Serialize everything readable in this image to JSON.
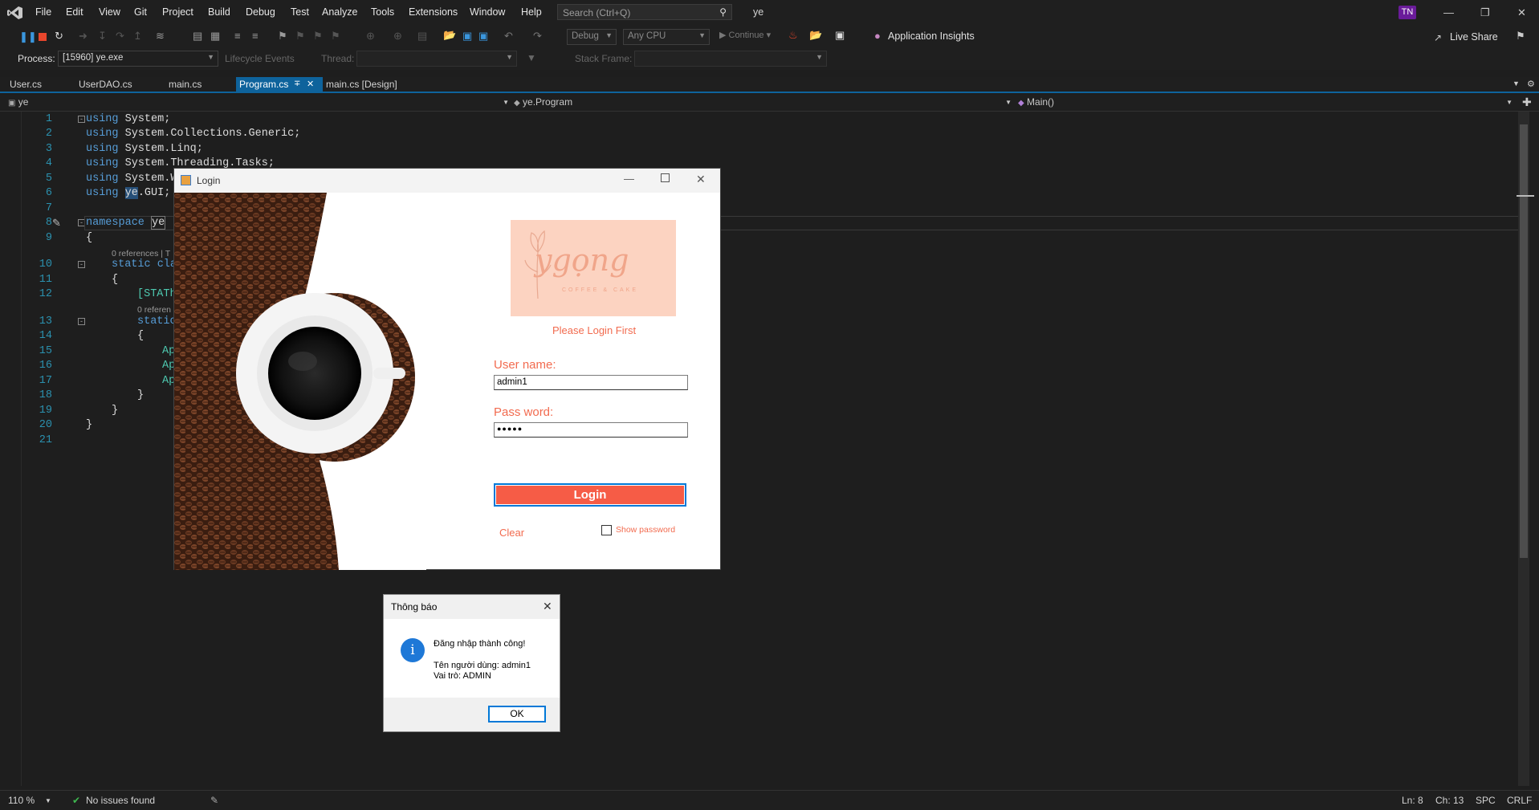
{
  "menu": [
    "File",
    "Edit",
    "View",
    "Git",
    "Project",
    "Build",
    "Debug",
    "Test",
    "Analyze",
    "Tools",
    "Extensions",
    "Window",
    "Help"
  ],
  "search": {
    "placeholder": "Search (Ctrl+Q)"
  },
  "solution_name": "ye",
  "user_initials": "TN",
  "toolbar": {
    "config": "Debug",
    "platform": "Any CPU",
    "continue_label": "Continue",
    "app_insights": "Application Insights",
    "live_share": "Live Share",
    "process_label": "Process:",
    "process_value": "[15960] ye.exe",
    "lifecycle": "Lifecycle Events",
    "thread_label": "Thread:",
    "stack_label": "Stack Frame:"
  },
  "tabs": [
    "User.cs",
    "UserDAO.cs",
    "main.cs",
    "Program.cs",
    "main.cs [Design]"
  ],
  "active_tab": "Program.cs",
  "navbar": {
    "project": "ye",
    "class": "ye.Program",
    "member": "Main()"
  },
  "code": {
    "line_numbers": [
      "1",
      "2",
      "3",
      "4",
      "5",
      "6",
      "7",
      "8",
      "9",
      "10",
      "11",
      "12",
      "13",
      "14",
      "15",
      "16",
      "17",
      "18",
      "19",
      "20",
      "21"
    ],
    "l1": "System;",
    "l2": "System.Collections.Generic;",
    "l3": "System.Linq;",
    "l4": "System.Threading.Tasks;",
    "l5": "System.W",
    "l6a": "ye",
    "l6b": ".GUI;",
    "using": "using",
    "namespace": "namespace",
    "ns_name": "ye",
    "brace_open": "{",
    "brace_close": "}",
    "static_cla": "static cla",
    "stath": "[STATh",
    "static": "static",
    "ap": "Ap",
    "refs1": "0 references | T",
    "refs2": "0 referen"
  },
  "status": {
    "zoom": "110 %",
    "issues": "No issues found",
    "ln": "Ln: 8",
    "ch": "Ch: 13",
    "spc": "SPC",
    "crlf": "CRLF"
  },
  "login": {
    "title": "Login",
    "logo_text": "ygọng",
    "logo_sub": "COFFEE & CAKE",
    "prompt": "Please Login First",
    "user_label": "User name:",
    "user_value": "admin1",
    "pass_label": "Pass word:",
    "pass_value": "●●●●●",
    "login_button": "Login",
    "clear_label": "Clear",
    "show_password": "Show password"
  },
  "msgbox": {
    "title": "Thông báo",
    "line1": "Đăng nhập thành công!",
    "line2": "Tên người dùng: admin1",
    "line3": "Vai trò: ADMIN",
    "ok": "OK"
  },
  "colors": {
    "accent": "#0e639c",
    "login_peach": "#f26b4f",
    "logo_bg": "#fcd3c1"
  }
}
